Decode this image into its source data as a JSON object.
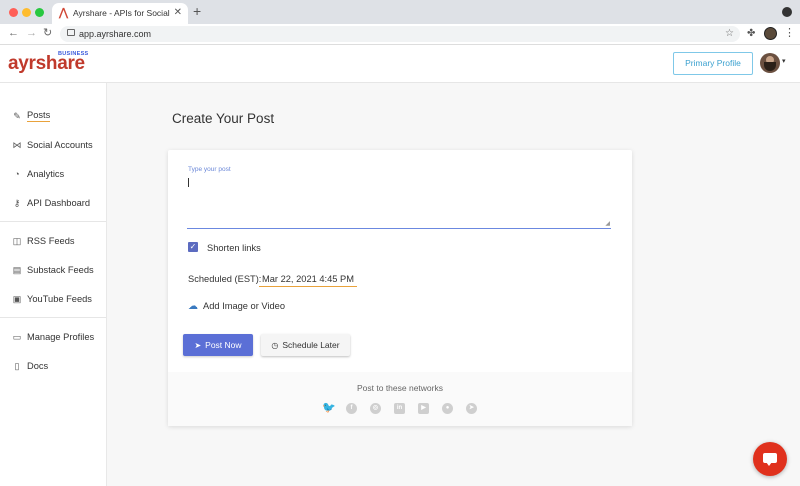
{
  "browser": {
    "tab_title": "Ayrshare - APIs for Social Media",
    "tab_close": "✕",
    "new_tab": "+",
    "url": "app.ayrshare.com"
  },
  "header": {
    "logo_text": "ayrshare",
    "logo_badge": "BUSINESS",
    "profile_button": "Primary Profile"
  },
  "sidebar": {
    "items": [
      {
        "label": "Posts",
        "icon": "posts-icon",
        "glyph": "✎",
        "active": true
      },
      {
        "label": "Social Accounts",
        "icon": "share-icon",
        "glyph": "⋈"
      },
      {
        "label": "Analytics",
        "icon": "chart-pie-icon",
        "glyph": "◔"
      },
      {
        "label": "API Dashboard",
        "icon": "key-icon",
        "glyph": "⚷"
      },
      {
        "label": "RSS Feeds",
        "icon": "rss-icon",
        "glyph": "◫"
      },
      {
        "label": "Substack Feeds",
        "icon": "substack-icon",
        "glyph": "▤"
      },
      {
        "label": "YouTube Feeds",
        "icon": "youtube-icon",
        "glyph": "▣"
      },
      {
        "label": "Manage Profiles",
        "icon": "id-card-icon",
        "glyph": "▭"
      },
      {
        "label": "Docs",
        "icon": "document-icon",
        "glyph": "▯"
      }
    ]
  },
  "main": {
    "title": "Create Your Post",
    "post_placeholder": "Type your post",
    "shorten_links": {
      "label": "Shorten links",
      "checked": true
    },
    "scheduled_label": "Scheduled (EST):",
    "scheduled_value": "Mar 22, 2021 4:45 PM",
    "add_media_label": "Add Image or Video",
    "post_now": "Post Now",
    "schedule_later": "Schedule Later",
    "networks_label": "Post to these networks",
    "networks": [
      {
        "name": "twitter",
        "glyph": "🐦",
        "color": "#1da1f2"
      },
      {
        "name": "facebook",
        "glyph": "f"
      },
      {
        "name": "instagram",
        "glyph": "◎"
      },
      {
        "name": "linkedin",
        "glyph": "in"
      },
      {
        "name": "youtube",
        "glyph": "▶"
      },
      {
        "name": "reddit",
        "glyph": "●"
      },
      {
        "name": "telegram",
        "glyph": "➤"
      }
    ]
  },
  "colors": {
    "brand": "#c0392b",
    "primary": "#5b6fd6",
    "accent_underline": "#e9a23b",
    "chat": "#e0311d"
  }
}
